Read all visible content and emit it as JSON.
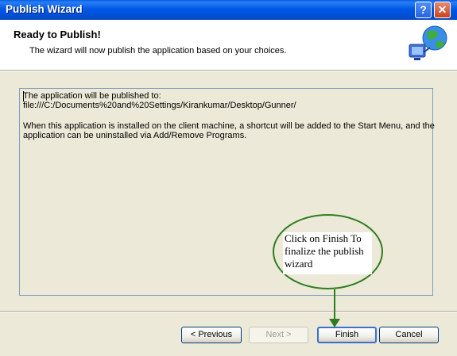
{
  "window": {
    "title": "Publish Wizard",
    "help_label": "?",
    "close_label": "✕"
  },
  "header": {
    "title": "Ready to Publish!",
    "subtitle": "The wizard will now publish the application based on your choices.",
    "icon": "globe-network-icon"
  },
  "content": {
    "line1": "The application will be published to:",
    "line2": "file:///C:/Documents%20and%20Settings/Kirankumar/Desktop/Gunner/",
    "line3": "When this application is installed on the client machine, a shortcut will be added to the Start Menu, and the",
    "line4": "application can be uninstalled via Add/Remove Programs."
  },
  "buttons": {
    "previous": "< Previous",
    "next": "Next >",
    "finish": "Finish",
    "cancel": "Cancel"
  },
  "annotation": {
    "line1": "Click on Finish To",
    "line2": "finalize the publish",
    "line3": "wizard",
    "color": "#2f7d1f"
  },
  "colors": {
    "titlebar": "#0058e6",
    "dialog_bg": "#ece9d8",
    "header_bg": "#ffffff",
    "box_border": "#7f9db9"
  }
}
